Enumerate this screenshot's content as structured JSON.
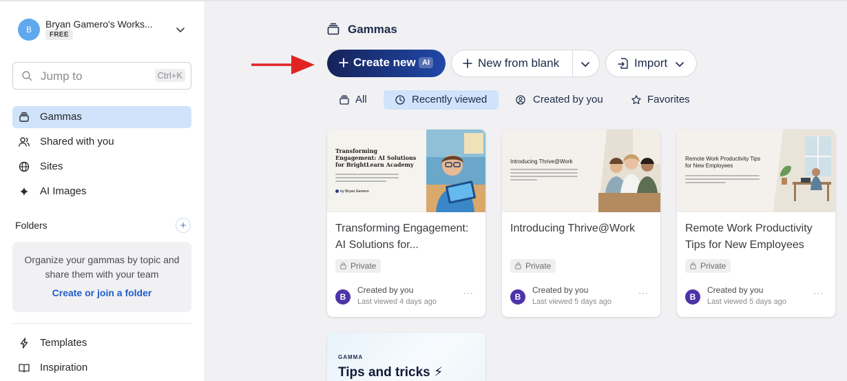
{
  "workspace": {
    "avatar_letter": "B",
    "name": "Bryan Gamero's Works...",
    "plan": "FREE"
  },
  "search": {
    "placeholder": "Jump to",
    "shortcut": "Ctrl+K"
  },
  "sidebar": {
    "items": [
      {
        "label": "Gammas",
        "icon": "stack-icon",
        "active": true
      },
      {
        "label": "Shared with you",
        "icon": "users-icon"
      },
      {
        "label": "Sites",
        "icon": "globe-icon"
      },
      {
        "label": "AI Images",
        "icon": "sparkle-icon"
      }
    ],
    "folders_title": "Folders",
    "folders_empty_text": "Organize your gammas by topic and share them with your team",
    "folders_link": "Create or join a folder",
    "bottom_items": [
      {
        "label": "Templates",
        "icon": "bolt-icon"
      },
      {
        "label": "Inspiration",
        "icon": "book-icon"
      }
    ]
  },
  "main": {
    "title": "Gammas",
    "buttons": {
      "create_new": "Create new",
      "create_new_badge": "AI",
      "new_from_blank": "New from blank",
      "import": "Import"
    },
    "filters": [
      {
        "label": "All",
        "icon": "stack-icon"
      },
      {
        "label": "Recently viewed",
        "icon": "clock-icon",
        "active": true
      },
      {
        "label": "Created by you",
        "icon": "user-circle-icon"
      },
      {
        "label": "Favorites",
        "icon": "star-icon"
      }
    ],
    "cards": [
      {
        "title": "Transforming Engagement: AI Solutions for...",
        "thumb_title": "Transforming Engagement: AI Solutions for BrightLearn Academy",
        "thumb_author": "by Bryan Gamero",
        "visibility": "Private",
        "avatar_letter": "B",
        "creator": "Created by you",
        "last_viewed": "Last viewed 4 days ago"
      },
      {
        "title": "Introducing Thrive@Work",
        "thumb_title": "Introducing Thrive@Work",
        "visibility": "Private",
        "avatar_letter": "B",
        "creator": "Created by you",
        "last_viewed": "Last viewed 5 days ago"
      },
      {
        "title": "Remote Work Productivity Tips for New Employees",
        "thumb_title": "Remote Work Productivity Tips for New Employees",
        "visibility": "Private",
        "avatar_letter": "B",
        "creator": "Created by you",
        "last_viewed": "Last viewed 5 days ago"
      }
    ],
    "tips_card": {
      "brand": "GAMMA",
      "title": "Tips and tricks ⚡"
    }
  },
  "colors": {
    "accent": "#cfe3fb",
    "primary_button": "#16235a",
    "arrow": "#e02424",
    "avatar": "#4c34a8"
  }
}
